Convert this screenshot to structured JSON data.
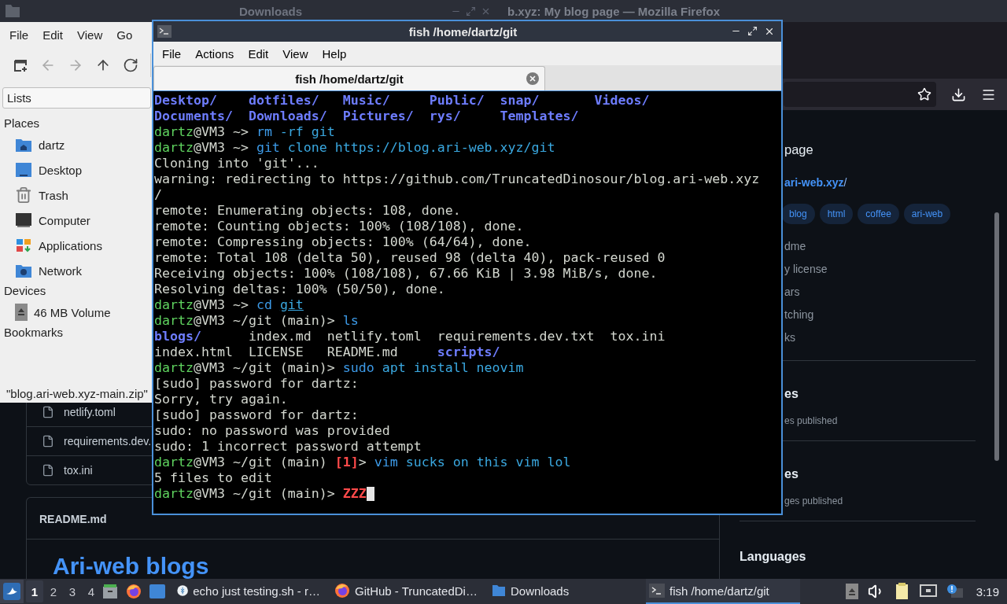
{
  "firefox": {
    "title": "b.xyz: My blog page — Mozilla Firefox",
    "page": {
      "files": [
        "netlify.toml",
        "requirements.dev.",
        "tox.ini"
      ],
      "readme": {
        "title": "README.md",
        "heading": "Ari-web blogs"
      },
      "sidebar": {
        "title": "page",
        "link": "ari-web.xyz",
        "link_tail": "/",
        "topics": [
          "blog",
          "html",
          "coffee",
          "ari-web"
        ],
        "links": [
          "dme",
          "y license",
          "ars",
          "tching",
          "ks"
        ],
        "sections": [
          {
            "heading": "es",
            "note": "es published"
          },
          {
            "heading": "es",
            "note": "ges published"
          }
        ],
        "languages": "Languages"
      }
    }
  },
  "file_manager": {
    "title": "Downloads",
    "menu": [
      "File",
      "Edit",
      "View",
      "Go"
    ],
    "toolbar": [
      {
        "kind": "new-tab",
        "disabled": false
      },
      {
        "kind": "back",
        "disabled": true
      },
      {
        "kind": "forward",
        "disabled": true
      },
      {
        "kind": "up",
        "disabled": false
      },
      {
        "kind": "reload",
        "disabled": false
      }
    ],
    "view": "Lists",
    "groups": [
      {
        "heading": "Places",
        "items": [
          {
            "label": "dartz",
            "kind": "home"
          },
          {
            "label": "Desktop",
            "kind": "desktop"
          },
          {
            "label": "Trash",
            "kind": "trash"
          },
          {
            "label": "Computer",
            "kind": "computer"
          },
          {
            "label": "Applications",
            "kind": "apps"
          },
          {
            "label": "Network",
            "kind": "network"
          }
        ]
      },
      {
        "heading": "Devices",
        "items": [
          {
            "label": "46 MB Volume",
            "kind": "drive"
          }
        ]
      },
      {
        "heading": "Bookmarks"
      }
    ],
    "status": "\"blog.ari-web.xyz-main.zip\""
  },
  "terminal": {
    "title": "fish /home/dartz/git",
    "menu": [
      "File",
      "Actions",
      "Edit",
      "View",
      "Help"
    ],
    "tabs": [
      {
        "label": "fish /home/dartz/git",
        "selected": true
      }
    ],
    "lines": [
      [
        {
          "kind": "dir",
          "text": "Desktop/    "
        },
        {
          "kind": "dir",
          "text": "dotfiles/   "
        },
        {
          "kind": "dir",
          "text": "Music/     "
        },
        {
          "kind": "dir",
          "text": "Public/  "
        },
        {
          "kind": "dir",
          "text": "snap/       "
        },
        {
          "kind": "dir",
          "text": "Videos/"
        }
      ],
      [
        {
          "kind": "dir",
          "text": "Documents/  "
        },
        {
          "kind": "dir",
          "text": "Downloads/  "
        },
        {
          "kind": "dir",
          "text": "Pictures/  "
        },
        {
          "kind": "dir",
          "text": "rys/     "
        },
        {
          "kind": "dir",
          "text": "Templates/"
        }
      ],
      [
        {
          "kind": "user",
          "text": "dartz"
        },
        {
          "kind": "plain",
          "text": "@VM3 ~> "
        },
        {
          "kind": "cmd",
          "text": "rm"
        },
        {
          "kind": "arg",
          "text": " -rf git"
        }
      ],
      [
        {
          "kind": "user",
          "text": "dartz"
        },
        {
          "kind": "plain",
          "text": "@VM3 ~> "
        },
        {
          "kind": "cmd",
          "text": "git"
        },
        {
          "kind": "arg",
          "text": " clone https://blog.ari-web.xyz/git"
        }
      ],
      [
        {
          "kind": "plain",
          "text": "Cloning into 'git'..."
        }
      ],
      [
        {
          "kind": "plain",
          "text": "warning: redirecting to https://github.com/TruncatedDinosour/blog.ari-web.xyz"
        }
      ],
      [
        {
          "kind": "plain",
          "text": "/"
        }
      ],
      [
        {
          "kind": "plain",
          "text": "remote: Enumerating objects: 108, done."
        }
      ],
      [
        {
          "kind": "plain",
          "text": "remote: Counting objects: 100% (108/108), done."
        }
      ],
      [
        {
          "kind": "plain",
          "text": "remote: Compressing objects: 100% (64/64), done."
        }
      ],
      [
        {
          "kind": "plain",
          "text": "remote: Total 108 (delta 50), reused 98 (delta 40), pack-reused 0"
        }
      ],
      [
        {
          "kind": "plain",
          "text": "Receiving objects: 100% (108/108), 67.66 KiB | 3.98 MiB/s, done."
        }
      ],
      [
        {
          "kind": "plain",
          "text": "Resolving deltas: 100% (50/50), done."
        }
      ],
      [
        {
          "kind": "user",
          "text": "dartz"
        },
        {
          "kind": "plain",
          "text": "@VM3 ~> "
        },
        {
          "kind": "cmd",
          "text": "cd "
        },
        {
          "kind": "argpath",
          "text": "git"
        }
      ],
      [
        {
          "kind": "user",
          "text": "dartz"
        },
        {
          "kind": "plain",
          "text": "@VM3 ~/git (main)> "
        },
        {
          "kind": "cmd",
          "text": "ls"
        }
      ],
      [
        {
          "kind": "dir",
          "text": "blogs/      "
        },
        {
          "kind": "plain",
          "text": "index.md  netlify.toml  requirements.dev.txt  tox.ini"
        }
      ],
      [
        {
          "kind": "plain",
          "text": "index.html  LICENSE   README.md     "
        },
        {
          "kind": "dir",
          "text": "scripts/"
        }
      ],
      [
        {
          "kind": "user",
          "text": "dartz"
        },
        {
          "kind": "plain",
          "text": "@VM3 ~/git (main)> "
        },
        {
          "kind": "cmd",
          "text": "sudo"
        },
        {
          "kind": "arg",
          "text": " apt install neovim"
        }
      ],
      [
        {
          "kind": "plain",
          "text": "[sudo] password for dartz:"
        }
      ],
      [
        {
          "kind": "plain",
          "text": "Sorry, try again."
        }
      ],
      [
        {
          "kind": "plain",
          "text": "[sudo] password for dartz:"
        }
      ],
      [
        {
          "kind": "plain",
          "text": "sudo: no password was provided"
        }
      ],
      [
        {
          "kind": "plain",
          "text": "sudo: 1 incorrect password attempt"
        }
      ],
      [
        {
          "kind": "user",
          "text": "dartz"
        },
        {
          "kind": "plain",
          "text": "@VM3 ~/git (main) "
        },
        {
          "kind": "error",
          "text": "[1]"
        },
        {
          "kind": "plain",
          "text": "> "
        },
        {
          "kind": "cmd",
          "text": "vim"
        },
        {
          "kind": "arg",
          "text": " sucks on this vim lol"
        }
      ],
      [
        {
          "kind": "plain",
          "text": "5 files to edit"
        }
      ],
      [
        {
          "kind": "user",
          "text": "dartz"
        },
        {
          "kind": "plain",
          "text": "@VM3 ~/git (main)> "
        },
        {
          "kind": "error",
          "text": "ZZZ"
        }
      ]
    ]
  },
  "taskbar": {
    "workspaces": [
      {
        "label": "1",
        "selected": true
      },
      {
        "label": "2",
        "selected": false
      },
      {
        "label": "3",
        "selected": false
      },
      {
        "label": "4",
        "selected": false
      }
    ],
    "tasks": [
      {
        "label": "echo just testing.sh - r…",
        "kind": "editor",
        "selected": false
      },
      {
        "label": "GitHub - TruncatedDi…",
        "kind": "firefox",
        "selected": false
      },
      {
        "label": "Downloads",
        "kind": "folder",
        "selected": false
      },
      {
        "label": "fish /home/dartz/git",
        "kind": "terminal",
        "selected": true
      }
    ],
    "clock": "3:19"
  }
}
